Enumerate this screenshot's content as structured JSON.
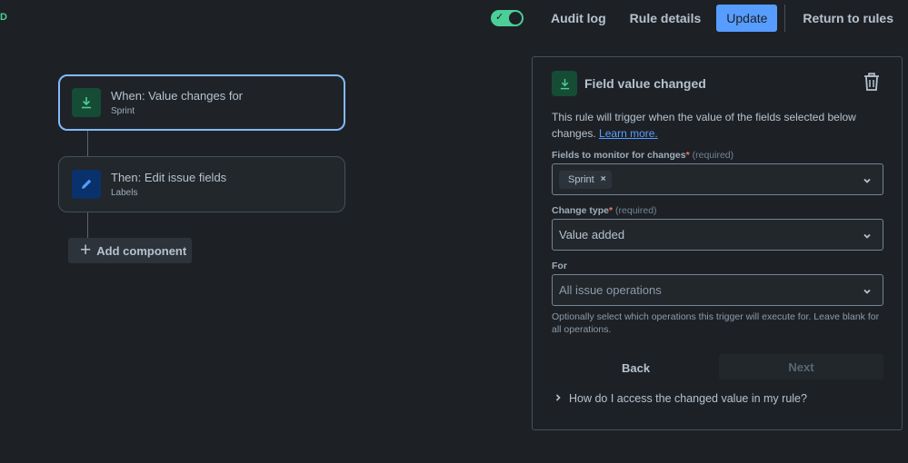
{
  "corner_tag": "D",
  "topbar": {
    "toggle_state": "on",
    "audit_log": "Audit log",
    "rule_details": "Rule details",
    "update": "Update",
    "return": "Return to rules"
  },
  "canvas": {
    "trigger": {
      "title": "When: Value changes for",
      "subtitle": "Sprint",
      "icon": "download-icon"
    },
    "action": {
      "title": "Then: Edit issue fields",
      "subtitle": "Labels",
      "icon": "pencil-icon"
    },
    "add_component": "Add component"
  },
  "panel": {
    "title": "Field value changed",
    "description": "This rule will trigger when the value of the fields selected below changes.",
    "learn_more": "Learn more.",
    "fields_label": "Fields to monitor for changes",
    "required_star": "*",
    "required_text": "(required)",
    "fields_chip": "Sprint",
    "chip_remove": "×",
    "change_type_label": "Change type",
    "change_type_value": "Value added",
    "for_label": "For",
    "for_placeholder": "All issue operations",
    "helper": "Optionally select which operations this trigger will execute for. Leave blank for all operations.",
    "back": "Back",
    "next": "Next",
    "faq": "How do I access the changed value in my rule?"
  },
  "colors": {
    "background": "#1d2125",
    "accent_blue": "#579dff",
    "toggle_green": "#4bce97",
    "required_red": "#f87168"
  }
}
